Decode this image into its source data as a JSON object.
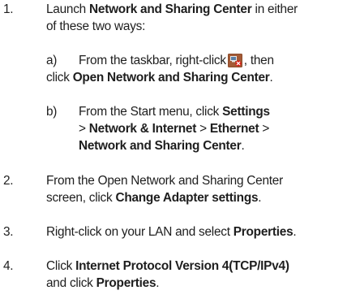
{
  "steps": [
    {
      "num": "1.",
      "line1_pre": "Launch ",
      "line1_bold": "Network and Sharing Center",
      "line1_post": " in either",
      "line2": "of these two ways:",
      "options": [
        {
          "marker": "a)",
          "text1": "From the taskbar, right-click",
          "text2": ", then",
          "text3": "click ",
          "bold1": "Open Network and Sharing Center",
          "end": "."
        },
        {
          "marker": "b)",
          "text1": "From the Start menu, click ",
          "bold1": "Settings",
          "sep1": "> ",
          "bold2": "Network & Internet",
          "sep2": " > ",
          "bold3": "Ethernet",
          "sep3": " >",
          "bold4": "Network and Sharing Center",
          "end": "."
        }
      ]
    },
    {
      "num": "2.",
      "line1": "From the Open Network and Sharing Center",
      "line2_pre": "screen, click ",
      "line2_bold": "Change Adapter settings",
      "line2_post": "."
    },
    {
      "num": "3.",
      "line1_pre": "Right-click on your LAN and select ",
      "line1_bold": "Properties",
      "line1_post": "."
    },
    {
      "num": "4.",
      "line1_pre": "Click ",
      "line1_bold": "Internet Protocol Version 4(TCP/IPv4)",
      "line2_pre": "and click ",
      "line2_bold": "Properties",
      "line2_post": "."
    }
  ],
  "icon": "network-tray-icon-with-red-x"
}
